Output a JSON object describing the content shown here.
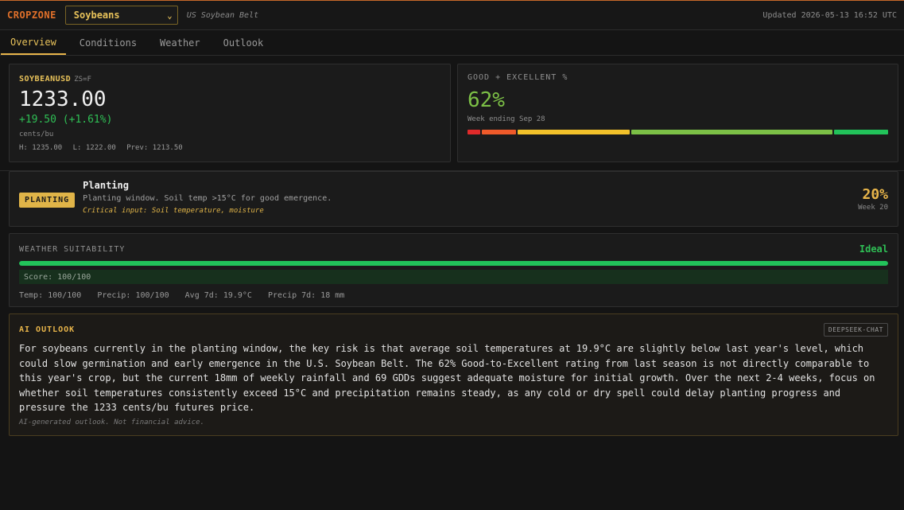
{
  "header": {
    "brand": "CROPZONE",
    "crop_selected": "Soybeans",
    "region": "US Soybean Belt",
    "updated": "Updated 2026-05-13 16:52 UTC"
  },
  "tabs": [
    {
      "label": "Overview",
      "active": true
    },
    {
      "label": "Conditions",
      "active": false
    },
    {
      "label": "Weather",
      "active": false
    },
    {
      "label": "Outlook",
      "active": false
    }
  ],
  "price": {
    "symbol": "SOYBEANUSD",
    "ticker": "ZS=F",
    "value": "1233.00",
    "change": "+19.50 (+1.61%)",
    "unit": "cents/bu",
    "high": "H: 1235.00",
    "low": "L: 1222.00",
    "prev": "Prev: 1213.50"
  },
  "condition": {
    "label": "GOOD + EXCELLENT %",
    "value": "62%",
    "week": "Week ending Sep 28",
    "segments": [
      {
        "name": "very-poor",
        "fraction": 0.015,
        "color": "#e02a2a"
      },
      {
        "name": "poor",
        "fraction": 0.04,
        "color": "#ef5a2a"
      },
      {
        "name": "fair",
        "fraction": 0.13,
        "color": "#f2c12a"
      },
      {
        "name": "good",
        "fraction": 0.235,
        "color": "#7cc046"
      },
      {
        "name": "excellent",
        "fraction": 0.063,
        "color": "#22c35a"
      }
    ]
  },
  "stage": {
    "badge": "PLANTING",
    "title": "Planting",
    "description": "Planting window. Soil temp >15°C for good emergence.",
    "critical": "Critical input: Soil temperature, moisture",
    "percent": "20%",
    "week": "Week 20"
  },
  "weather": {
    "label": "WEATHER SUITABILITY",
    "rating": "Ideal",
    "score_fraction": 1.0,
    "score_text": "Score: 100/100",
    "temp": "Temp: 100/100",
    "precip": "Precip: 100/100",
    "avg7d": "Avg 7d: 19.9°C",
    "precip7d": "Precip 7d: 18 mm"
  },
  "ai": {
    "title": "AI OUTLOOK",
    "model": "DEEPSEEK-CHAT",
    "text": "For soybeans currently in the planting window, the key risk is that average soil temperatures at 19.9°C are slightly below last year's level, which could slow germination and early emergence in the U.S. Soybean Belt. The 62% Good-to-Excellent rating from last season is not directly comparable to this year's crop, but the current 18mm of weekly rainfall and 69 GDDs suggest adequate moisture for initial growth. Over the next 2-4 weeks, focus on whether soil temperatures consistently exceed 15°C and precipitation remains steady, as any cold or dry spell could delay planting progress and pressure the 1233 cents/bu futures price.",
    "disclaimer": "AI-generated outlook. Not financial advice."
  }
}
